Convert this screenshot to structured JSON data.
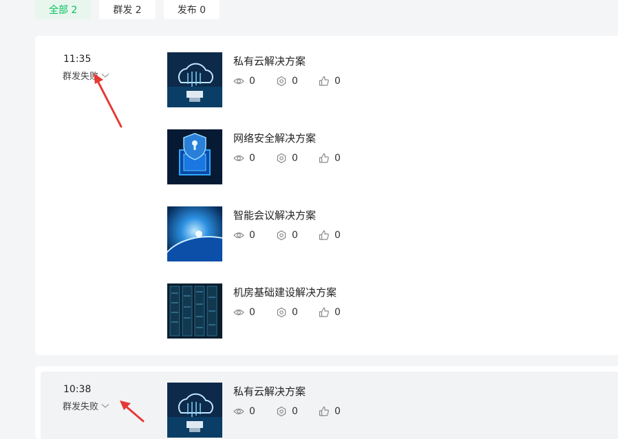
{
  "tabs": [
    {
      "label": "全部 2",
      "active": true
    },
    {
      "label": "群发 2",
      "active": false
    },
    {
      "label": "发布 0",
      "active": false
    }
  ],
  "groups": [
    {
      "time": "11:35",
      "status": "群发失败",
      "articles": [
        {
          "title": "私有云解决方案",
          "thumb": "cloud",
          "views": "0",
          "shares": "0",
          "likes": "0"
        },
        {
          "title": "网络安全解决方案",
          "thumb": "security",
          "views": "0",
          "shares": "0",
          "likes": "0"
        },
        {
          "title": "智能会议解决方案",
          "thumb": "earth",
          "views": "0",
          "shares": "0",
          "likes": "0"
        },
        {
          "title": "机房基础建设解决方案",
          "thumb": "servers",
          "views": "0",
          "shares": "0",
          "likes": "0"
        }
      ]
    },
    {
      "time": "10:38",
      "status": "群发失败",
      "articles": [
        {
          "title": "私有云解决方案",
          "thumb": "cloud",
          "views": "0",
          "shares": "0",
          "likes": "0"
        }
      ]
    }
  ],
  "icons": {
    "views": "eye-icon",
    "shares": "share-icon",
    "likes": "thumbs-up-icon",
    "status_toggle": "chevron-down-icon"
  },
  "colors": {
    "accent": "#07c160",
    "annotation": "#e53935"
  }
}
